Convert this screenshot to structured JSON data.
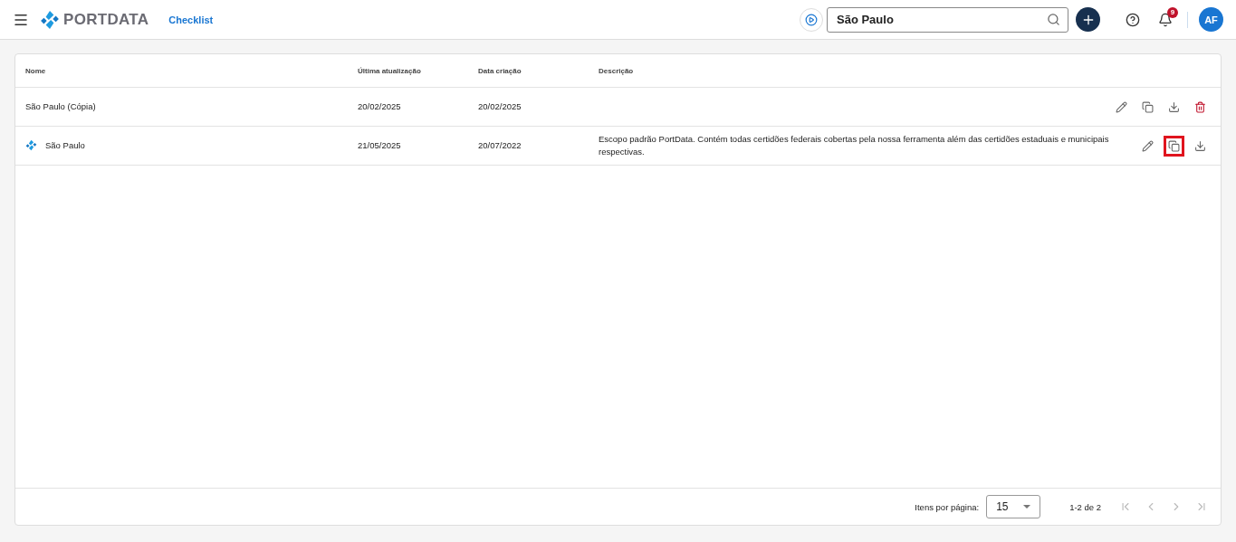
{
  "header": {
    "brand": "PORTDATA",
    "page_title": "Checklist",
    "search": {
      "value": "São Paulo"
    },
    "notifications_count": "9",
    "avatar": "AF"
  },
  "table": {
    "columns": [
      "Nome",
      "Última atualização",
      "Data criação",
      "Descrição"
    ],
    "rows": [
      {
        "kind": "copy",
        "name": "São Paulo (Cópia)",
        "updated": "20/02/2025",
        "created": "20/02/2025",
        "actions": [
          {
            "kind": "edit",
            "highlighted": false
          },
          {
            "kind": "copy",
            "highlighted": false
          },
          {
            "kind": "download",
            "highlighted": false
          },
          {
            "kind": "delete",
            "highlighted": false
          }
        ]
      },
      {
        "kind": "default",
        "name": "São Paulo",
        "updated": "21/05/2025",
        "created": "20/07/2022",
        "description": "Escopo padrão PortData. Contém todas certidões federais cobertas pela nossa ferramenta além das certidões estaduais e municipais respectivas.",
        "actions": [
          {
            "kind": "edit",
            "highlighted": false
          },
          {
            "kind": "copy",
            "highlighted": true
          },
          {
            "kind": "download",
            "highlighted": false
          }
        ]
      }
    ]
  },
  "pagination": {
    "label": "Itens por página:",
    "page_size": "15",
    "range": "1-2 de 2"
  }
}
